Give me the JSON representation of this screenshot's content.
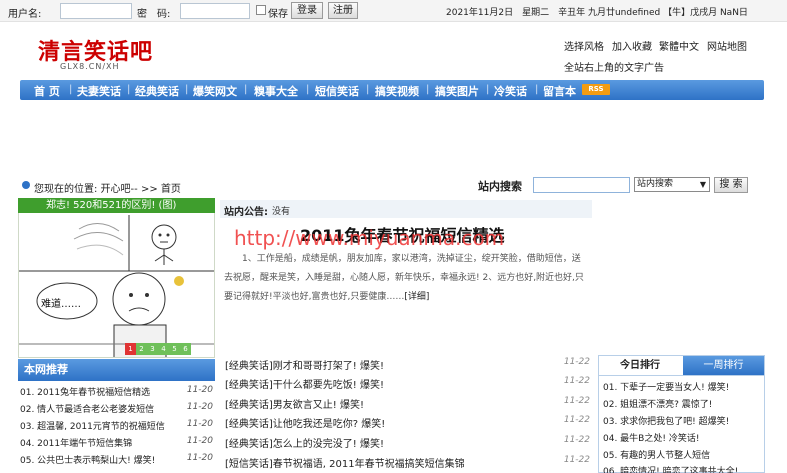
{
  "topbar": {
    "username_label": "用户名:",
    "password_label": "密　码:",
    "save_label": "保存",
    "login_button": "登录",
    "register_button": "注册",
    "date_text": "2021年11月2日　星期二　辛丑年 九月廿undefined 【牛】戊戌月 NaN日"
  },
  "header": {
    "logo_title": "清言笑话吧",
    "logo_subtitle": "GLX8.CN/XH",
    "links": [
      "选择风格",
      "加入收藏",
      "繁體中文",
      "网站地图"
    ],
    "ad_text": "全站右上角的文字广告"
  },
  "nav": {
    "items": [
      "首 页",
      "夫妻笑话",
      "经典笑话",
      "爆笑网文",
      "糗事大全",
      "短信笑话",
      "搞笑视频",
      "搞笑图片",
      "冷笑话",
      "留言本"
    ],
    "rss": "RSS"
  },
  "location": {
    "text": "您现在的位置: 开心吧-- >> 首页"
  },
  "search": {
    "label": "站内搜索",
    "select_value": "站内搜索",
    "button": "搜 索"
  },
  "image_box": {
    "caption": "郑志! 520和521的区别! (图)",
    "speech": "难道……",
    "pages": [
      "1",
      "2",
      "3",
      "4",
      "5",
      "6"
    ]
  },
  "notice": {
    "label": "站内公告:",
    "text": "没有"
  },
  "featured": {
    "title": "2011兔年春节祝福短信精选",
    "watermark": "http://www.miyuanma.com",
    "body": "1、工作是船，成绩是帆，朋友加库，家以港湾，洗掉证尘，绽开笑脸，借助短信，送去祝愿，醒来是笑，入睡是甜，心随人愿，新年快乐，幸福永远! 2、远方也好,附近也好,只要记得就好!平淡也好,富贵也好,只要健康……",
    "more": "[详细]"
  },
  "hot_list": [
    {
      "title": "[经典笑话]刚才和哥哥打架了! 爆笑!",
      "date": "11-22"
    },
    {
      "title": "[经典笑话]干什么都要先吃饭! 爆笑!",
      "date": "11-22"
    },
    {
      "title": "[经典笑话]男友欲言又止! 爆笑!",
      "date": "11-22"
    },
    {
      "title": "[经典笑话]让他吃我还是吃你? 爆笑!",
      "date": "11-22"
    },
    {
      "title": "[经典笑话]怎么上的没完没了! 爆笑!",
      "date": "11-22"
    },
    {
      "title": "[短信笑话]春节祝福语, 2011年春节祝福搞笑短信集锦",
      "date": "11-22"
    }
  ],
  "recommend": {
    "heading": "本网推荐",
    "items": [
      {
        "title": "01. 2011兔年春节祝福短信精选",
        "date": "11-20"
      },
      {
        "title": "02. 情人节最适合老公老婆发短信",
        "date": "11-20"
      },
      {
        "title": "03. 超温馨, 2011元宵节的祝福短信",
        "date": "11-20"
      },
      {
        "title": "04. 2011年端午节短信集锦",
        "date": "11-20"
      },
      {
        "title": "05. 公共巴士表示鸭梨山大! 爆笑!",
        "date": "11-20"
      }
    ]
  },
  "ranking": {
    "tab_today": "今日排行",
    "tab_week": "一周排行",
    "items": [
      "01. 下辈子一定要当女人! 爆笑!",
      "02. 姐姐漂不漂亮? 震惊了!",
      "03. 求求你把我包了吧! 超爆笑!",
      "04. 最牛B之处! 冷笑话!",
      "05. 有趣的男人节整人短信",
      "06. 暗恋情况! 暗恋了这事共大全!"
    ]
  }
}
